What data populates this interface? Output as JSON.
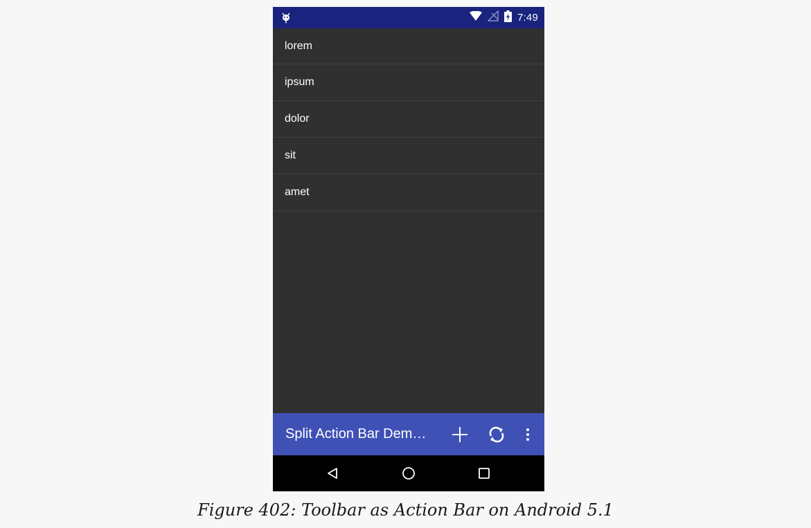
{
  "status_bar": {
    "time": "7:49",
    "icons": [
      "android-debug-icon",
      "wifi-icon",
      "no-signal-icon",
      "battery-charging-icon"
    ],
    "background": "#1a237e"
  },
  "list": {
    "items": [
      "lorem",
      "ipsum",
      "dolor",
      "sit",
      "amet"
    ]
  },
  "toolbar": {
    "title": "Split Action Bar Dem…",
    "actions": [
      "add-icon",
      "refresh-icon",
      "overflow-menu-icon"
    ],
    "background": "#3f51b5"
  },
  "nav_bar": {
    "buttons": [
      "back-icon",
      "home-icon",
      "recents-icon"
    ]
  },
  "caption": "Figure 402: Toolbar as Action Bar on Android 5.1",
  "colors": {
    "list_background": "#303030",
    "page_background": "#f7f7f7"
  }
}
